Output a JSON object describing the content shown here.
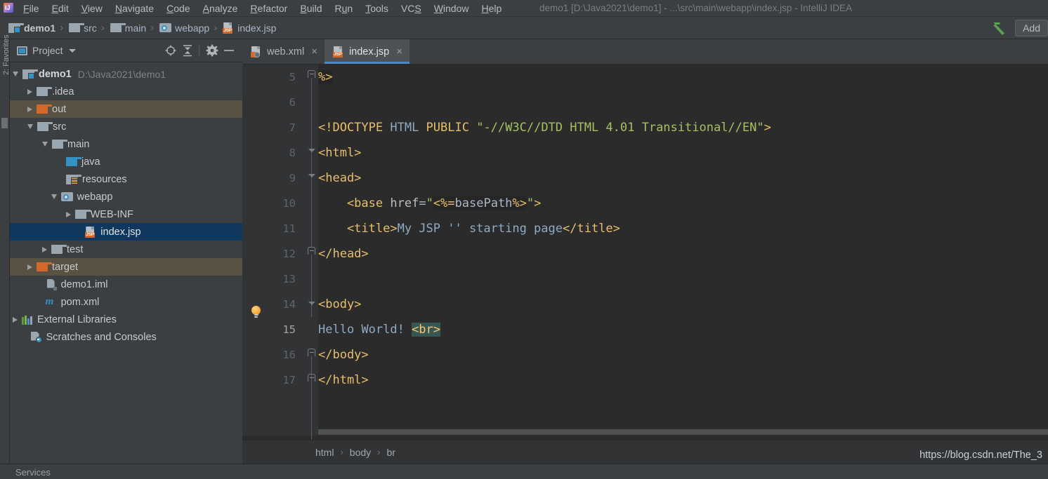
{
  "window": {
    "title": "demo1 [D:\\Java2021\\demo1] - ...\\src\\main\\webapp\\index.jsp - IntelliJ IDEA",
    "logo_text": "IJ"
  },
  "menubar": {
    "items": [
      {
        "label": "File",
        "mnemonic": "F"
      },
      {
        "label": "Edit",
        "mnemonic": "E"
      },
      {
        "label": "View",
        "mnemonic": "V"
      },
      {
        "label": "Navigate",
        "mnemonic": "N"
      },
      {
        "label": "Code",
        "mnemonic": "C"
      },
      {
        "label": "Analyze",
        "mnemonic": "A"
      },
      {
        "label": "Refactor",
        "mnemonic": "R"
      },
      {
        "label": "Build",
        "mnemonic": "B"
      },
      {
        "label": "Run",
        "mnemonic": "u"
      },
      {
        "label": "Tools",
        "mnemonic": "T"
      },
      {
        "label": "VCS",
        "mnemonic": "S"
      },
      {
        "label": "Window",
        "mnemonic": "W"
      },
      {
        "label": "Help",
        "mnemonic": "H"
      }
    ]
  },
  "navbar": {
    "crumbs": [
      {
        "label": "demo1",
        "icon": "module-icon"
      },
      {
        "label": "src",
        "icon": "folder-icon"
      },
      {
        "label": "main",
        "icon": "folder-icon"
      },
      {
        "label": "webapp",
        "icon": "webapp-folder-icon"
      },
      {
        "label": "index.jsp",
        "icon": "jsp-file-icon"
      }
    ],
    "separator": "›",
    "add_button_label": "Add",
    "run_icon": "green-arrow-icon"
  },
  "left_toolstrip": {
    "label": "2: Favorites"
  },
  "project_panel": {
    "title": "Project",
    "title_icon": "project-toolwindow-icon",
    "toolbar_icons": [
      {
        "name": "scroll-from-source-icon"
      },
      {
        "name": "collapse-all-icon"
      },
      {
        "name": "gear-icon"
      },
      {
        "name": "hide-icon"
      }
    ],
    "tree": [
      {
        "label": "demo1",
        "sub": "D:\\Java2021\\demo1",
        "indent": 0,
        "state": "expanded",
        "icon": "module-icon",
        "bold": true,
        "row_style": "none"
      },
      {
        "label": ".idea",
        "sub": "",
        "indent": 1,
        "state": "collapsed",
        "icon": "folder-icon",
        "bold": false,
        "row_style": "none"
      },
      {
        "label": "out",
        "sub": "",
        "indent": 1,
        "state": "collapsed",
        "icon": "folder-orange-icon",
        "bold": false,
        "row_style": "olive"
      },
      {
        "label": "src",
        "sub": "",
        "indent": 1,
        "state": "expanded",
        "icon": "folder-icon",
        "bold": false,
        "row_style": "none"
      },
      {
        "label": "main",
        "sub": "",
        "indent": 2,
        "state": "expanded",
        "icon": "folder-icon",
        "bold": false,
        "row_style": "none"
      },
      {
        "label": "java",
        "sub": "",
        "indent": 3,
        "state": "leaf",
        "icon": "folder-blue-icon",
        "bold": false,
        "row_style": "none"
      },
      {
        "label": "resources",
        "sub": "",
        "indent": 3,
        "state": "leaf",
        "icon": "resources-folder-icon",
        "bold": false,
        "row_style": "none"
      },
      {
        "label": "webapp",
        "sub": "",
        "indent": 2.6,
        "state": "expanded",
        "icon": "webapp-folder-icon",
        "bold": false,
        "row_style": "none"
      },
      {
        "label": "WEB-INF",
        "sub": "",
        "indent": 3.6,
        "state": "collapsed",
        "icon": "folder-icon",
        "bold": false,
        "row_style": "none"
      },
      {
        "label": "index.jsp",
        "sub": "",
        "indent": 4.3,
        "state": "leaf",
        "icon": "jsp-file-icon",
        "bold": false,
        "row_style": "selected"
      },
      {
        "label": "test",
        "sub": "",
        "indent": 2,
        "state": "collapsed",
        "icon": "folder-icon",
        "bold": false,
        "row_style": "none"
      },
      {
        "label": "target",
        "sub": "",
        "indent": 1,
        "state": "collapsed",
        "icon": "folder-orange-icon",
        "bold": false,
        "row_style": "olive"
      },
      {
        "label": "demo1.iml",
        "sub": "",
        "indent": 1.6,
        "state": "leaf",
        "icon": "iml-file-icon",
        "bold": false,
        "row_style": "none"
      },
      {
        "label": "pom.xml",
        "sub": "",
        "indent": 1.6,
        "state": "leaf",
        "icon": "maven-file-icon",
        "bold": false,
        "row_style": "none"
      },
      {
        "label": "External Libraries",
        "sub": "",
        "indent": 0,
        "state": "collapsed",
        "icon": "libraries-icon",
        "bold": false,
        "row_style": "none"
      },
      {
        "label": "Scratches and Consoles",
        "sub": "",
        "indent": 0.6,
        "state": "leaf",
        "icon": "scratches-icon",
        "bold": false,
        "row_style": "none"
      }
    ]
  },
  "editor": {
    "tabs": [
      {
        "label": "web.xml",
        "icon": "xml-file-icon",
        "active": false,
        "close": "×"
      },
      {
        "label": "index.jsp",
        "icon": "jsp-file-icon",
        "active": true,
        "close": "×"
      }
    ],
    "current_line": 15,
    "lines": [
      {
        "num": "5",
        "tokens": [
          {
            "t": "%>",
            "c": "tagc jspbg"
          }
        ]
      },
      {
        "num": "6",
        "tokens": []
      },
      {
        "num": "7",
        "tokens": [
          {
            "t": "<!DOCTYPE ",
            "c": "tagc"
          },
          {
            "t": "HTML ",
            "c": "bluec"
          },
          {
            "t": "PUBLIC ",
            "c": "tagc"
          },
          {
            "t": "\"-//W3C//DTD HTML 4.01 Transitional//EN\"",
            "c": "strc"
          },
          {
            "t": ">",
            "c": "tagc"
          }
        ]
      },
      {
        "num": "8",
        "tokens": [
          {
            "t": "<html>",
            "c": "tagc"
          }
        ]
      },
      {
        "num": "9",
        "tokens": [
          {
            "t": "<head>",
            "c": "tagc"
          }
        ]
      },
      {
        "num": "10",
        "tokens": [
          {
            "t": "    <base ",
            "c": "tagc"
          },
          {
            "t": "href",
            "c": "attrn"
          },
          {
            "t": "=",
            "c": "txtc"
          },
          {
            "t": "\"",
            "c": "strc"
          },
          {
            "t": "<%=",
            "c": "tagc jspbg"
          },
          {
            "t": "basePath",
            "c": "txtc jspbg"
          },
          {
            "t": "%>",
            "c": "tagc jspbg"
          },
          {
            "t": "\"",
            "c": "strc"
          },
          {
            "t": ">",
            "c": "tagc"
          }
        ]
      },
      {
        "num": "11",
        "tokens": [
          {
            "t": "    <title>",
            "c": "tagc"
          },
          {
            "t": "My JSP '' starting page",
            "c": "bluec"
          },
          {
            "t": "</title>",
            "c": "tagc"
          }
        ]
      },
      {
        "num": "12",
        "tokens": [
          {
            "t": "</head>",
            "c": "tagc"
          }
        ]
      },
      {
        "num": "13",
        "tokens": []
      },
      {
        "num": "14",
        "tokens": [
          {
            "t": "<body>",
            "c": "tagc"
          }
        ]
      },
      {
        "num": "15",
        "tokens": [
          {
            "t": "Hello World! ",
            "c": "bluec"
          },
          {
            "t": "<br>",
            "c": "brtxt brsel"
          }
        ]
      },
      {
        "num": "16",
        "tokens": [
          {
            "t": "</body>",
            "c": "tagc"
          }
        ]
      },
      {
        "num": "17",
        "tokens": [
          {
            "t": "</html>",
            "c": "tagc"
          }
        ]
      }
    ],
    "breadcrumb": [
      "html",
      "body",
      "br"
    ],
    "breadcrumb_separator": "›",
    "inspection_icon": "lightbulb-icon"
  },
  "statusbar": {
    "services_label": "Services",
    "watermark": "https://blog.csdn.net/The_3"
  },
  "colors": {
    "panel_bg": "#3c3f41",
    "editor_bg": "#2b2b2b",
    "gutter_bg": "#313335",
    "accent_blue": "#4a88c7",
    "selection_blue": "#10385e",
    "olive_row": "#595243",
    "tag_orange": "#e8bf6a",
    "string_green": "#a5c261",
    "text_blue": "#8eaac4",
    "br_highlight": "#375752"
  }
}
